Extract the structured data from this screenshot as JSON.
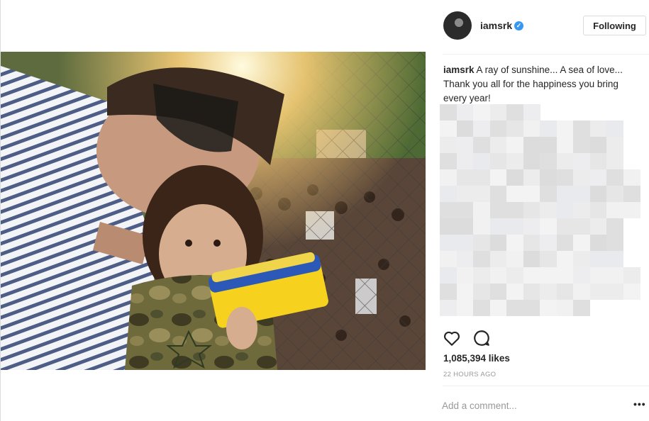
{
  "post": {
    "username": "iamsrk",
    "verified_icon": "verified-badge-icon",
    "follow_label": "Following",
    "caption_user": "iamsrk",
    "caption_text": " A ray of sunshine... A sea of love... Thank you all for the happiness you bring every year!",
    "likes": "1,085,394 likes",
    "time": "22 HOURS AGO",
    "comment_placeholder": "Add a comment...",
    "more_label": "•••"
  },
  "icons": {
    "like": "heart-icon",
    "comment": "comment-icon",
    "avatar": "avatar",
    "more": "more-options-icon"
  },
  "colors": {
    "accent": "#3897f0",
    "text": "#262626",
    "muted": "#999999",
    "border": "#dbdbdb"
  }
}
